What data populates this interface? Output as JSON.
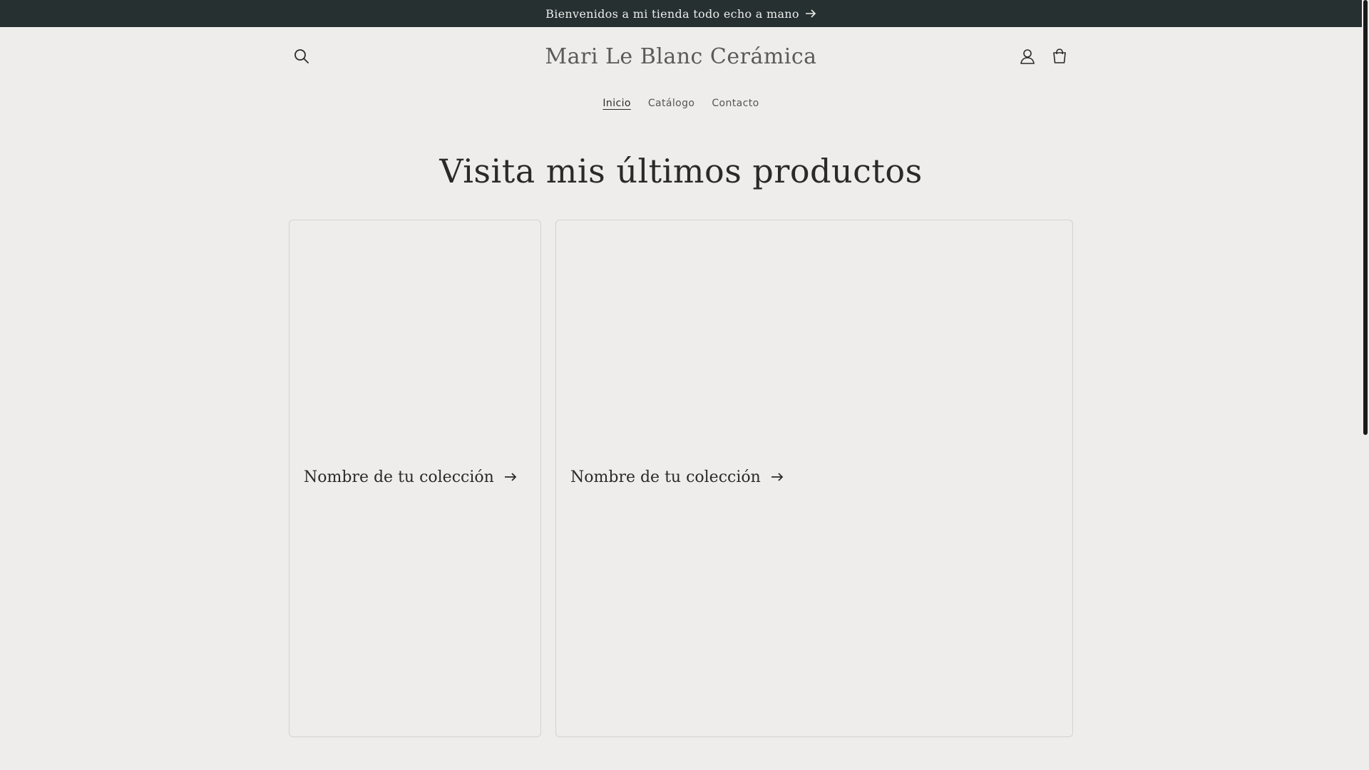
{
  "announcement": {
    "text": "Bienvenidos a mi tienda todo echo a mano"
  },
  "header": {
    "logo": "Mari Le Blanc Cerámica",
    "nav": [
      {
        "label": "Inicio",
        "active": true
      },
      {
        "label": "Catálogo",
        "active": false
      },
      {
        "label": "Contacto",
        "active": false
      }
    ]
  },
  "main": {
    "section_title": "Visita mis últimos productos",
    "collections": [
      {
        "title": "Nombre de tu colección"
      },
      {
        "title": "Nombre de tu colección"
      }
    ]
  },
  "colors": {
    "announcement_bg": "#273030",
    "page_bg": "#efedeb",
    "text": "#2a2a2a",
    "card_border": "#d4d2cf"
  },
  "icons": [
    "search-icon",
    "account-icon",
    "cart-icon",
    "arrow-right-icon"
  ]
}
